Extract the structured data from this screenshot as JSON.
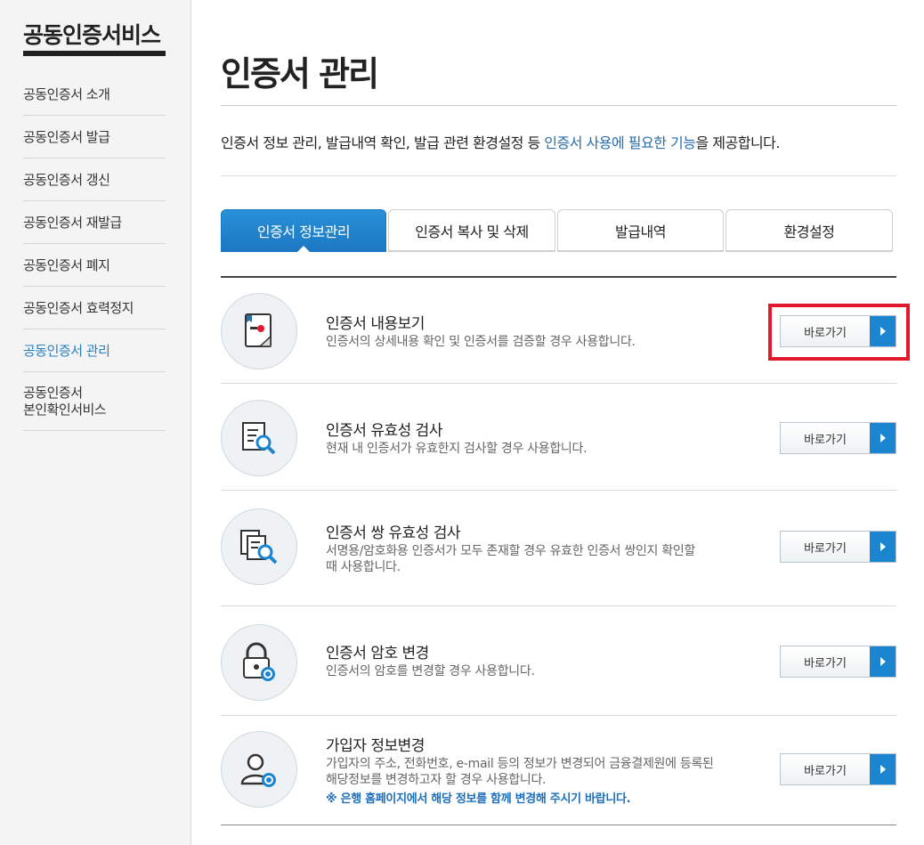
{
  "sidebar": {
    "title": "공동인증서비스",
    "items": [
      {
        "label": "공동인증서 소개"
      },
      {
        "label": "공동인증서 발급"
      },
      {
        "label": "공동인증서 갱신"
      },
      {
        "label": "공동인증서 재발급"
      },
      {
        "label": "공동인증서 폐지"
      },
      {
        "label": "공동인증서 효력정지"
      },
      {
        "label": "공동인증서 관리"
      },
      {
        "label": "공동인증서\n본인확인서비스"
      }
    ],
    "active_index": 6
  },
  "page": {
    "title": "인증서 관리",
    "intro_prefix": "인증서 정보 관리, 발급내역 확인, 발급 관련 환경설정 등 ",
    "intro_highlight": "인증서 사용에 필요한 기능",
    "intro_suffix": "을 제공합니다."
  },
  "tabs": [
    {
      "label": "인증서 정보관리",
      "active": true
    },
    {
      "label": "인증서 복사 및 삭제",
      "active": false
    },
    {
      "label": "발급내역",
      "active": false
    },
    {
      "label": "환경설정",
      "active": false
    }
  ],
  "features": [
    {
      "title": "인증서 내용보기",
      "desc": "인증서의 상세내용 확인 및 인증서를 검증할 경우 사용합니다.",
      "icon": "certificate-view-icon",
      "button": "바로가기"
    },
    {
      "title": "인증서 유효성 검사",
      "desc": "현재 내 인증서가 유효한지 검사할 경우 사용합니다.",
      "icon": "certificate-validate-icon",
      "button": "바로가기"
    },
    {
      "title": "인증서 쌍 유효성 검사",
      "desc": "서명용/암호화용 인증서가 모두 존재할 경우 유효한 인증서 쌍인지 확인할 때 사용합니다.",
      "icon": "certificate-pair-validate-icon",
      "button": "바로가기"
    },
    {
      "title": "인증서 암호 변경",
      "desc": "인증서의 암호를 변경할 경우 사용합니다.",
      "icon": "lock-change-icon",
      "button": "바로가기"
    },
    {
      "title": "가입자 정보변경",
      "desc": "가입자의 주소, 전화번호, e-mail 등의 정보가 변경되어 금융결제원에 등록된 해당정보를 변경하고자 할 경우 사용합니다.",
      "note": "※ 은행 홈페이지에서 해당 정보를 함께 변경해 주시기 바랍니다.",
      "icon": "user-change-icon",
      "button": "바로가기"
    }
  ],
  "colors": {
    "accent": "#1c85cf",
    "highlight": "#e2192c",
    "active_menu": "#2a7fc0"
  }
}
